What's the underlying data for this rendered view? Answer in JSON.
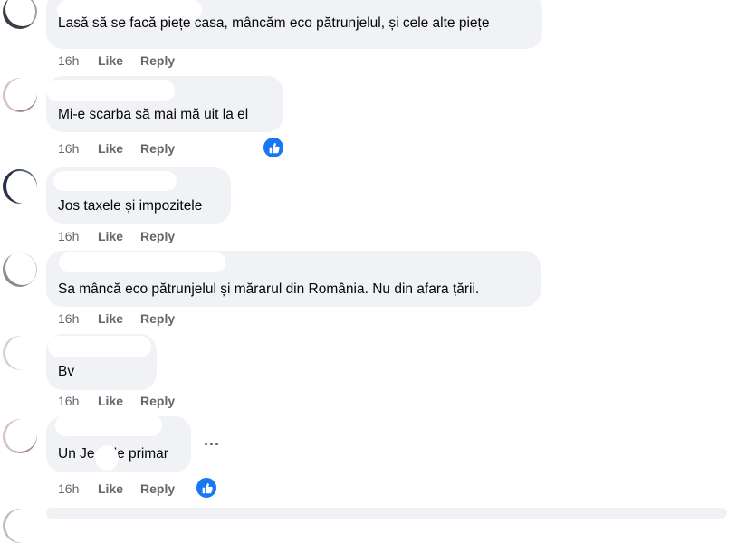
{
  "comments": [
    {
      "text": "Lasă să se facă piețe casa, mâncăm eco pătrunjelul, și cele alte piețe",
      "time": "16h",
      "like": "Like",
      "reply": "Reply",
      "name_fragment": ""
    },
    {
      "text": "Mi-e scarba să mai mă uit la el",
      "time": "16h",
      "like": "Like",
      "reply": "Reply",
      "name_fragment": ""
    },
    {
      "text": "Jos taxele și impozitele",
      "time": "16h",
      "like": "Like",
      "reply": "Reply",
      "name_fragment": ""
    },
    {
      "text": "Sa mâncă eco pătrunjelul și mărarul din România. Nu din afara țării.",
      "time": "16h",
      "like": "Like",
      "reply": "Reply",
      "name_fragment": ""
    },
    {
      "text": "Bv",
      "time": "16h",
      "like": "Like",
      "reply": "Reply",
      "name_fragment": ""
    },
    {
      "text_before": "Un Je",
      "text_after": "de primar",
      "time": "16h",
      "like": "Like",
      "reply": "Reply",
      "name_fragment": "",
      "more": "..."
    }
  ],
  "colors": {
    "bubble": "#f0f2f5",
    "meta": "#65676b",
    "text": "#050505",
    "like_reaction": "#1877f2"
  }
}
